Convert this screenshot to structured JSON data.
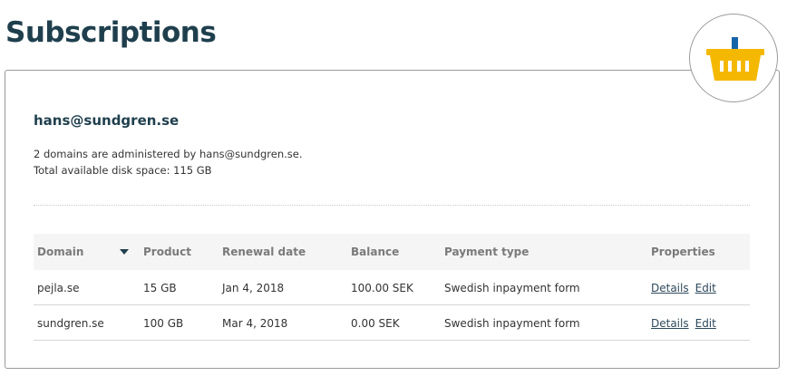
{
  "page": {
    "title": "Subscriptions"
  },
  "colors": {
    "title": "#1f3f4d",
    "basket_body": "#f5b800",
    "basket_handle": "#1565a8",
    "border": "#9a9a9a"
  },
  "badge": {
    "icon": "basket-icon"
  },
  "account": {
    "email": "hans@sundgren.se",
    "domains_text": "2 domains are administered by hans@sundgren.se.",
    "disk_text": "Total available disk space: 115 GB"
  },
  "table": {
    "headers": {
      "domain": "Domain",
      "product": "Product",
      "renewal": "Renewal date",
      "balance": "Balance",
      "payment": "Payment type",
      "properties": "Properties"
    },
    "sort_icon": "caret-down-icon",
    "rows": [
      {
        "domain": "pejla.se",
        "product": "15 GB",
        "renewal": "Jan 4, 2018",
        "balance": "100.00 SEK",
        "payment": "Swedish inpayment form",
        "details": "Details",
        "edit": "Edit"
      },
      {
        "domain": "sundgren.se",
        "product": "100 GB",
        "renewal": "Mar 4, 2018",
        "balance": "0.00 SEK",
        "payment": "Swedish inpayment form",
        "details": "Details",
        "edit": "Edit"
      }
    ]
  }
}
